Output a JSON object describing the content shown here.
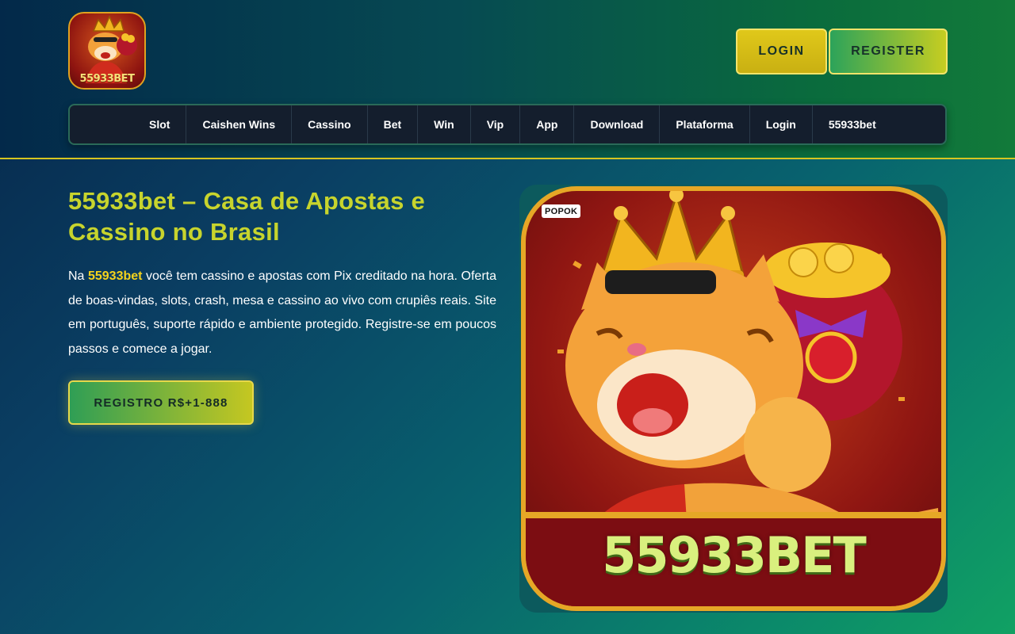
{
  "header": {
    "logo_text": "55933BET",
    "login_label": "LOGIN",
    "register_label": "REGISTER"
  },
  "nav": {
    "items": [
      {
        "label": "Slot"
      },
      {
        "label": "Caishen Wins"
      },
      {
        "label": "Cassino"
      },
      {
        "label": "Bet"
      },
      {
        "label": "Win"
      },
      {
        "label": "Vip"
      },
      {
        "label": "App"
      },
      {
        "label": "Download"
      },
      {
        "label": "Plataforma"
      },
      {
        "label": "Login"
      },
      {
        "label": "55933bet"
      }
    ]
  },
  "hero": {
    "title": "55933bet – Casa de Apostas e Cassino no Brasil",
    "text_prefix": "Na ",
    "text_brand": "55933bet",
    "text_body": " você tem cassino e apostas com Pix creditado na hora. Oferta de boas-vindas, slots, crash, mesa e cassino ao vivo com crupiês reais. Site em português, suporte rápido e ambiente protegido. Registre-se em poucos passos e comece a jogar.",
    "cta_label": "REGISTRO R$+1-888",
    "image_badge": "POPOK",
    "image_brand": "55933BET"
  },
  "colors": {
    "accent_yellow": "#c7d42d",
    "brand_highlight": "#f4d21c",
    "nav_bg": "#141e2d",
    "gold_border": "#e6a726"
  },
  "icons": {
    "logo": "tiger-mascot-icon",
    "hero_image": "tiger-king-with-coin-bag-illustration"
  }
}
